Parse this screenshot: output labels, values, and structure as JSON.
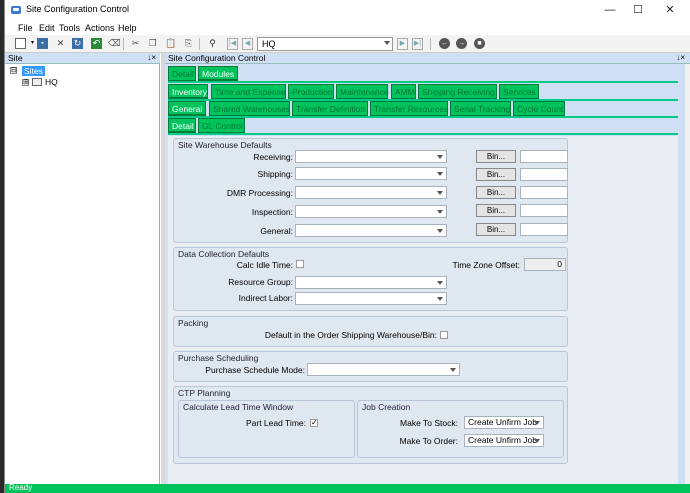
{
  "window": {
    "title": "Site Configuration Control",
    "minimize": "—",
    "maximize": "☐",
    "close": "✕"
  },
  "menu": [
    "File",
    "Edit",
    "Tools",
    "Actions",
    "Help"
  ],
  "toolbar": {
    "search_value": "HQ"
  },
  "site_panel": {
    "title": "Site",
    "pin": "↓×",
    "root": "Sites",
    "root_expander": "⊟",
    "child": "HQ",
    "child_expander": "⊞"
  },
  "main_panel": {
    "title": "Site Configuration Control",
    "pin": "↓×"
  },
  "tabs_row1": [
    "Detail",
    "Modules"
  ],
  "tabs_row2": [
    "Inventory",
    "Time and Expense",
    "Production",
    "Maintenance",
    "AMM",
    "Shipping Receiving",
    "Services"
  ],
  "tabs_row3": [
    "General",
    "Shared Warehouses",
    "Transfer Definition",
    "Transfer Resources",
    "Serial Tracking",
    "Cycle Count"
  ],
  "tabs_row4": [
    "Detail",
    "GL Control"
  ],
  "warehouse_defaults": {
    "title": "Site Warehouse Defaults",
    "bin_label": "Bin...",
    "rows": [
      "Receiving:",
      "Shipping:",
      "DMR Processing:",
      "Inspection:",
      "General:"
    ]
  },
  "data_collection": {
    "title": "Data Collection Defaults",
    "calc_idle_time": "Calc Idle Time:",
    "time_zone_offset": "Time Zone Offset:",
    "time_zone_value": "0",
    "resource_group": "Resource Group:",
    "indirect_labor": "Indirect Labor:"
  },
  "packing": {
    "title": "Packing",
    "default_label": "Default in the Order Shipping Warehouse/Bin:"
  },
  "purchase_scheduling": {
    "title": "Purchase Scheduling",
    "mode_label": "Purchase Schedule Mode:"
  },
  "ctp": {
    "title": "CTP Planning",
    "lead_time_title": "Calculate Lead Time Window",
    "part_lead_time": "Part Lead Time:",
    "part_lead_checked": "✓",
    "job_creation_title": "Job Creation",
    "make_to_stock": "Make To Stock:",
    "make_to_stock_value": "Create Unfirm Job",
    "make_to_order": "Make To Order:",
    "make_to_order_value": "Create Unfirm Job"
  },
  "status": {
    "text": "Ready"
  },
  "colors": {
    "accent": "#00c35c",
    "panel": "#cfe0f5"
  }
}
